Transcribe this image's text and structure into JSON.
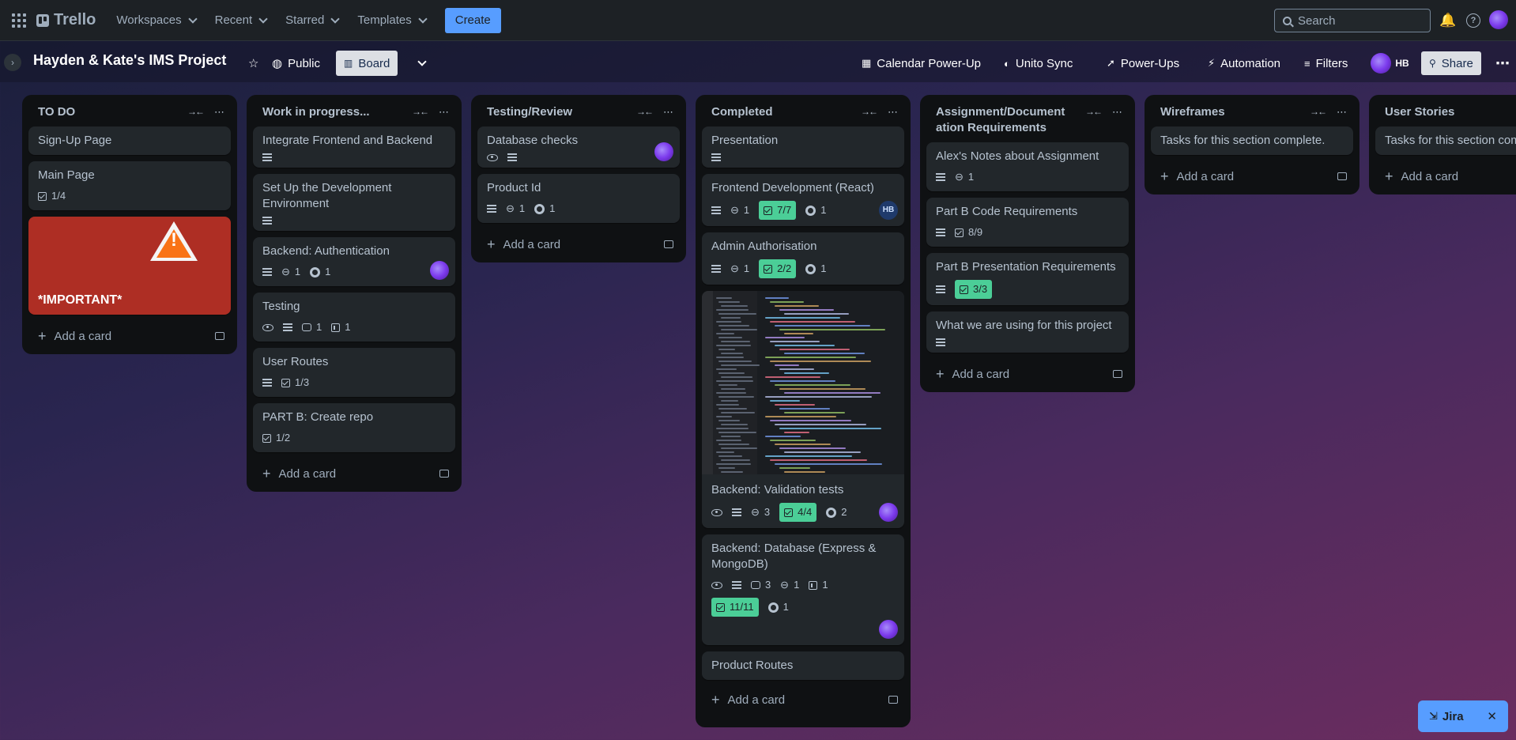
{
  "topbar": {
    "logo": "Trello",
    "nav": [
      "Workspaces",
      "Recent",
      "Starred",
      "Templates"
    ],
    "create": "Create",
    "search_placeholder": "Search"
  },
  "board": {
    "title": "Hayden & Kate's IMS Project",
    "visibility": "Public",
    "view": "Board",
    "calendar": "Calendar Power-Up",
    "unito": "Unito Sync",
    "powerups": "Power-Ups",
    "automation": "Automation",
    "filters": "Filters",
    "member_initials": "HB",
    "share": "Share"
  },
  "add_card_label": "Add a card",
  "lists": [
    {
      "title": "TO DO",
      "cards": [
        {
          "title": "Sign-Up Page"
        },
        {
          "title": "Main Page",
          "checklist": "1/4"
        },
        {
          "title": "*IMPORTANT*"
        }
      ]
    },
    {
      "title": "Work in progress...",
      "cards": [
        {
          "title": "Integrate Frontend and Backend"
        },
        {
          "title": "Set Up the Development Environment"
        },
        {
          "title": "Backend: Authentication",
          "attachments": "1",
          "github": "1"
        },
        {
          "title": "Testing",
          "comments": "1",
          "trello": "1"
        },
        {
          "title": "User Routes",
          "checklist": "1/3"
        },
        {
          "title": "PART B: Create repo",
          "checklist": "1/2"
        }
      ]
    },
    {
      "title": "Testing/Review",
      "cards": [
        {
          "title": "Database checks"
        },
        {
          "title": "Product Id",
          "attachments": "1",
          "github": "1"
        }
      ]
    },
    {
      "title": "Completed",
      "cards": [
        {
          "title": "Presentation"
        },
        {
          "title": "Frontend Development (React)",
          "attachments": "1",
          "checklist": "7/7",
          "github": "1",
          "member": "HB"
        },
        {
          "title": "Admin Authorisation",
          "attachments": "1",
          "checklist": "2/2",
          "github": "1"
        },
        {
          "title": "Backend: Validation tests",
          "attachments": "3",
          "checklist": "4/4",
          "github": "2"
        },
        {
          "title": "Backend: Database (Express & MongoDB)",
          "comments": "3",
          "attachments": "1",
          "trello": "1",
          "checklist": "11/11",
          "github": "1"
        },
        {
          "title": "Product Routes"
        }
      ]
    },
    {
      "title": "Assignment/Documentation Requirements",
      "cards": [
        {
          "title": "Alex's Notes about Assignment",
          "attachments": "1"
        },
        {
          "title": "Part B Code Requirements",
          "checklist": "8/9"
        },
        {
          "title": "Part B Presentation Requirements",
          "checklist": "3/3"
        },
        {
          "title": "What we are using for this project"
        }
      ]
    },
    {
      "title": "Wireframes",
      "cards": [
        {
          "title": "Tasks for this section complete."
        }
      ]
    },
    {
      "title": "User Stories",
      "cards": [
        {
          "title": "Tasks for this section complete."
        }
      ]
    }
  ],
  "jira": {
    "label": "Jira",
    "close": "✕"
  }
}
